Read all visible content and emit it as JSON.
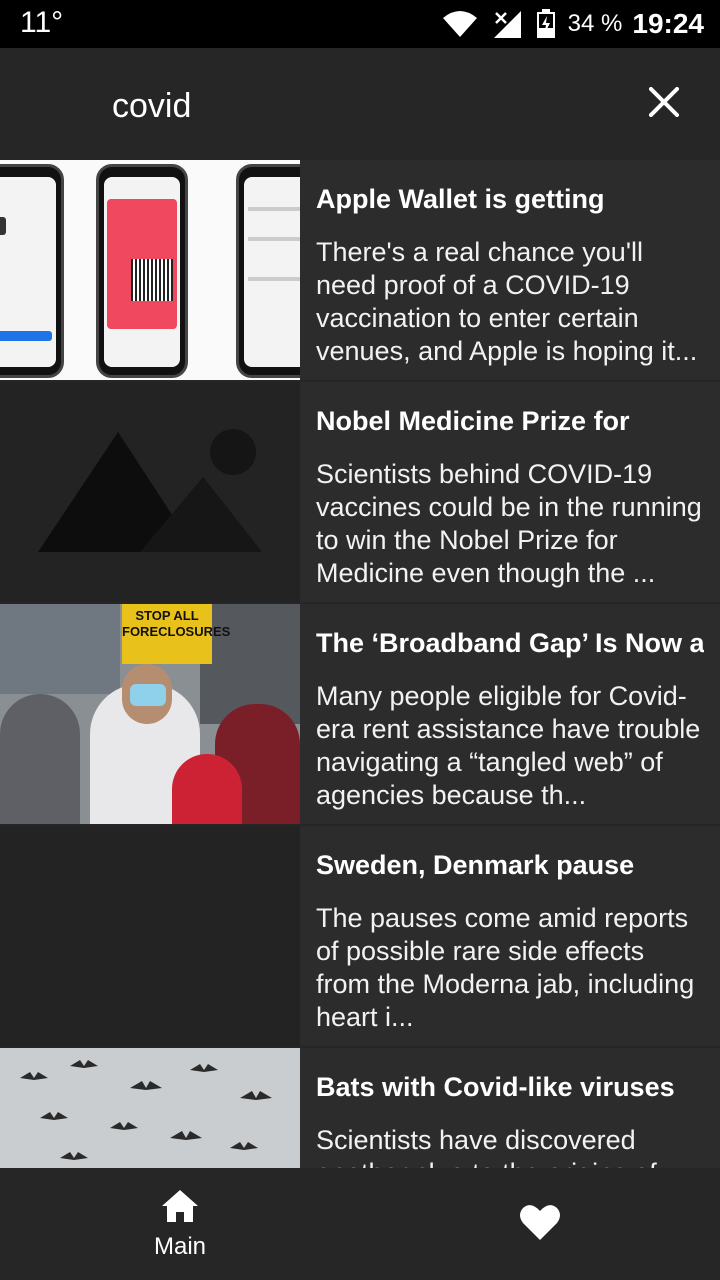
{
  "status_bar": {
    "temperature": "11°",
    "battery_percent": "34 %",
    "time": "19:24"
  },
  "search": {
    "query": "covid"
  },
  "results": [
    {
      "title": "Apple Wallet is getting",
      "snippet": "There's a real chance you'll need proof of a COVID-19 vaccination to enter certain venues, and Apple is hoping it...",
      "thumbnail": "phones-vaccination-card"
    },
    {
      "title": "Nobel Medicine Prize for",
      "snippet": "Scientists behind COVID-19 vaccines could be in the running to win the Nobel Prize for Medicine even though the ...",
      "thumbnail": "image-placeholder-icon"
    },
    {
      "title": "The ‘Broadband Gap’ Is Now a",
      "snippet": "Many people eligible for Covid-era rent assistance have trouble navigating a “tangled web” of agencies because th...",
      "thumbnail": "protest-photo",
      "sign_text": "STOP ALL FORECLOSURES"
    },
    {
      "title": "Sweden, Denmark pause",
      "snippet": "The pauses come amid reports of possible rare side effects from the Moderna jab, including heart i...",
      "thumbnail": "empty"
    },
    {
      "title": "Bats with Covid-like viruses",
      "snippet": "Scientists have discovered another clue to the origins of",
      "thumbnail": "bats-photo"
    }
  ],
  "bottom_nav": {
    "main_label": "Main",
    "main_icon": "home-icon",
    "favorites_icon": "heart-icon"
  }
}
